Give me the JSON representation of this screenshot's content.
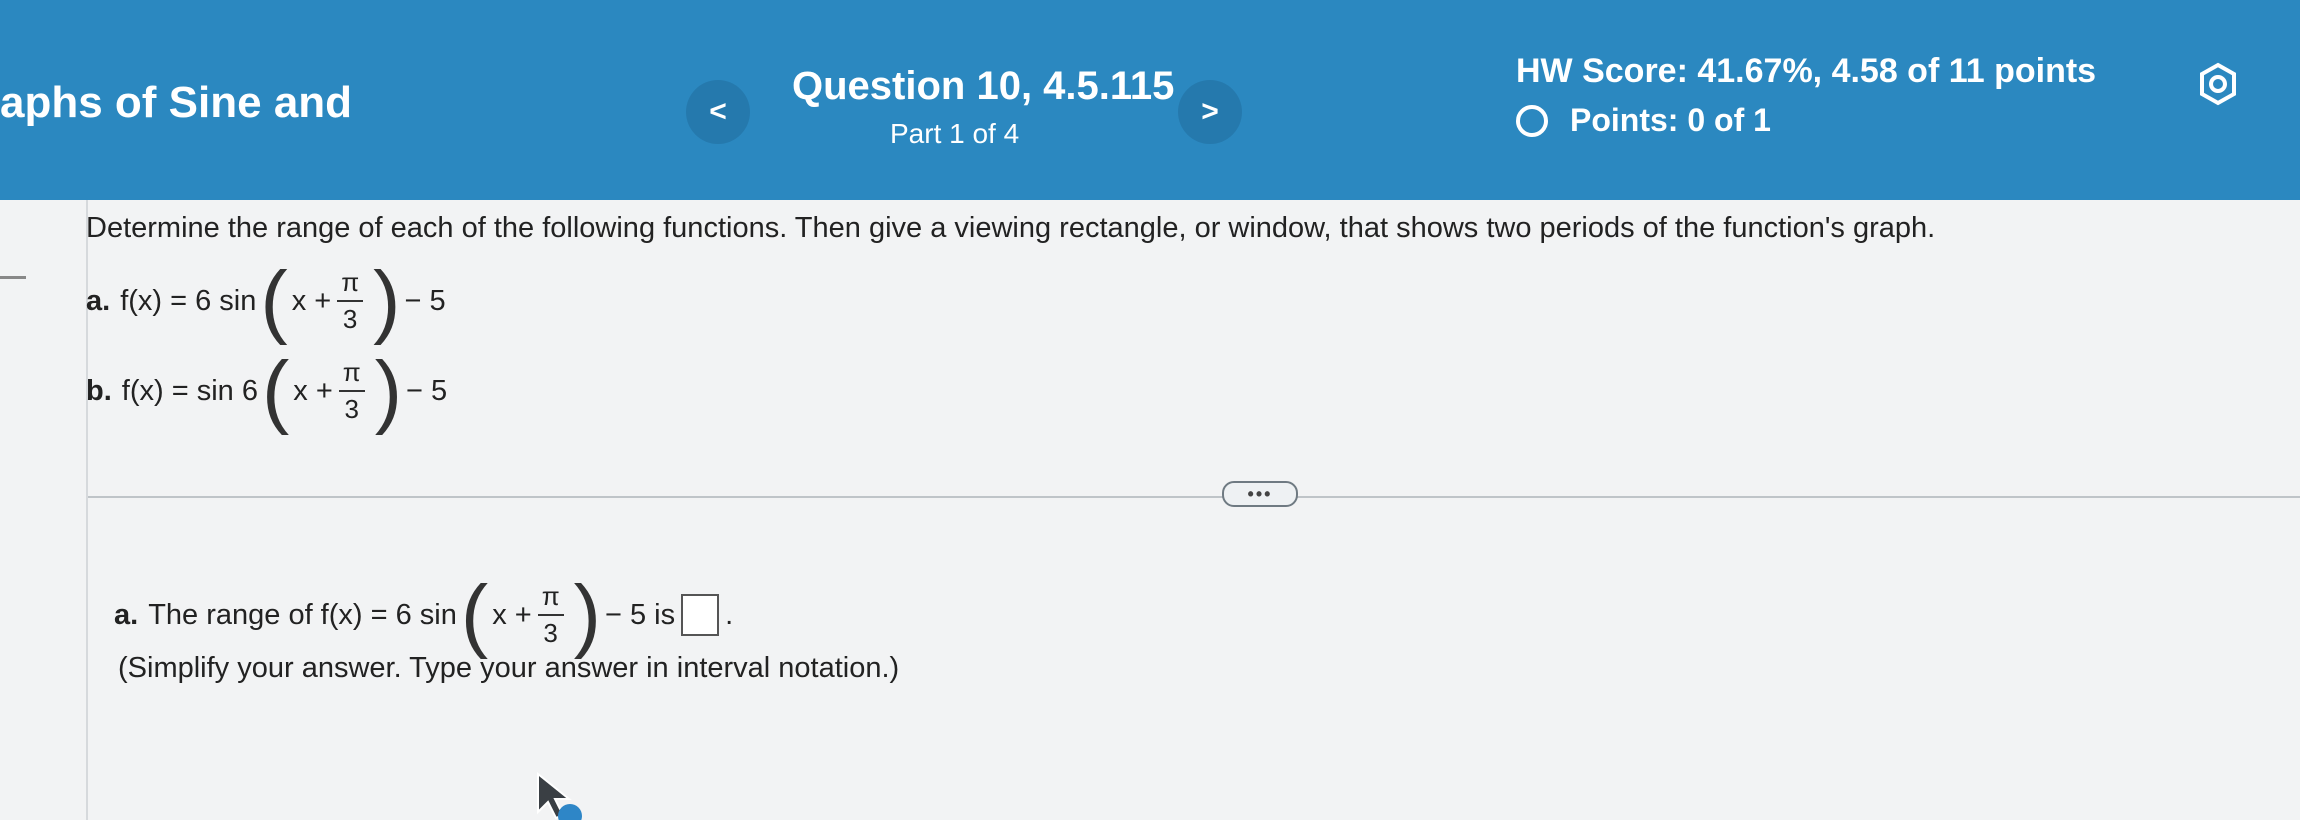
{
  "header": {
    "course_title": "aphs of Sine and",
    "question_title": "Question 10, 4.5.115",
    "part": "Part 1 of 4",
    "hw_score": "HW Score: 41.67%, 4.58 of 11 points",
    "points": "Points: 0 of 1",
    "prev_label": "<",
    "next_label": ">",
    "settings_icon": "gear-icon"
  },
  "question": {
    "prompt": "Determine the range of each of the following functions. Then give a viewing rectangle, or window, that shows two periods of the function's graph.",
    "a": {
      "label": "a.",
      "lhs": "f(x) = 6 sin",
      "inner": "x +",
      "num": "π",
      "den": "3",
      "tail": "− 5"
    },
    "b": {
      "label": "b.",
      "lhs": "f(x) = sin 6",
      "inner": "x +",
      "num": "π",
      "den": "3",
      "tail": "− 5"
    }
  },
  "more_label": "•••",
  "answer": {
    "label": "a.",
    "pre": "The range of f(x) = 6 sin",
    "inner": "x +",
    "num": "π",
    "den": "3",
    "post": "− 5 is",
    "end": ".",
    "hint": "(Simplify your answer. Type your answer in interval notation.)"
  }
}
